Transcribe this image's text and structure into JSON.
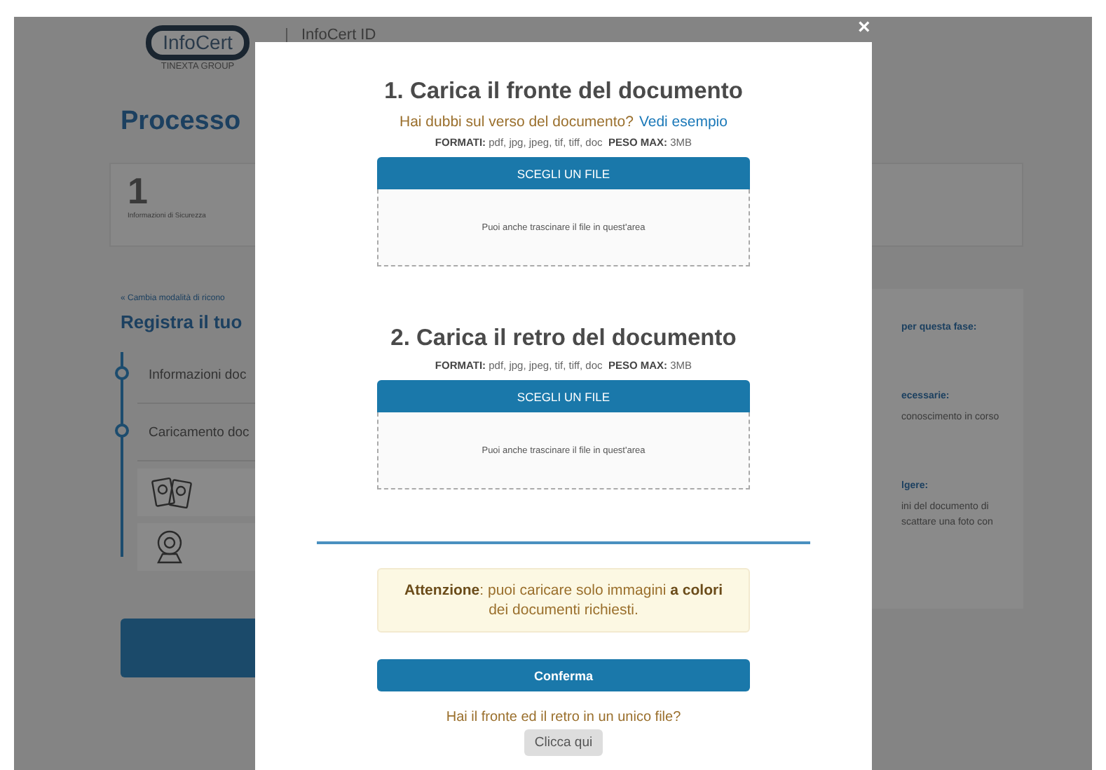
{
  "header": {
    "logo_text": "InfoCert",
    "logo_subtext": "TINEXTA GROUP",
    "product": "InfoCert ID"
  },
  "page": {
    "title": "Processo",
    "step": {
      "number": "1",
      "label": "Informazioni di Sicurezza"
    },
    "back_link": "« Cambia modalità di ricono",
    "section_title": "Registra il tuo",
    "timeline": [
      {
        "label": "Informazioni doc"
      },
      {
        "label": "Caricamento doc"
      }
    ],
    "options": [
      {
        "kind": "document"
      },
      {
        "kind": "webcam"
      }
    ]
  },
  "side_panel": [
    {
      "kind": "heading",
      "text": "per questa fase:"
    },
    {
      "kind": "heading",
      "text": "ecessarie:"
    },
    {
      "kind": "line",
      "text": "conoscimento in corso"
    },
    {
      "kind": "heading",
      "text": "lgere:"
    },
    {
      "kind": "line",
      "text": "ini del documento di"
    },
    {
      "kind": "line",
      "text": "scattare una foto con"
    }
  ],
  "modal": {
    "close": "×",
    "sections": [
      {
        "title": "1. Carica il fronte del documento",
        "hint": "Hai dubbi sul verso del documento?",
        "hint_link": "Vedi esempio",
        "formats": "**FORMATI:** pdf, jpg, jpeg, tif, tiff, doc  **PESO MAX:** 3MB",
        "button": "SCEGLI UN FILE",
        "dropzone": "Puoi anche trascinare il file in quest'area"
      },
      {
        "title": "2. Carica il retro del documento",
        "formats": "**FORMATI:** pdf, jpg, jpeg, tif, tiff, doc  **PESO MAX:** 3MB",
        "button": "SCEGLI UN FILE",
        "dropzone": "Puoi anche trascinare il file in quest'area"
      }
    ],
    "warning": "**Attenzione**: puoi caricare solo immagini **a colori** dei documenti richiesti.",
    "confirm": "Conferma",
    "single_file_question": "Hai il fronte ed il retro in un unico file?",
    "single_file_button": "Clicca qui"
  }
}
